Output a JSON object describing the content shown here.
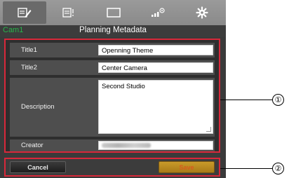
{
  "tabs": [
    {
      "icon": "metadata-edit-icon",
      "active": true
    },
    {
      "icon": "clip-list-icon",
      "active": false
    },
    {
      "icon": "monitor-icon",
      "active": false
    },
    {
      "icon": "signal-settings-icon",
      "active": false
    },
    {
      "icon": "gear-icon",
      "active": false
    }
  ],
  "header": {
    "camera": "Cam1",
    "title": "Planning Metadata"
  },
  "form": {
    "title1": {
      "label": "Title1",
      "value": "Openning Theme"
    },
    "title2": {
      "label": "Title2",
      "value": "Center Camera"
    },
    "description": {
      "label": "Description",
      "value": "Second Studio"
    },
    "creator": {
      "label": "Creator",
      "value": "(blurred)"
    }
  },
  "buttons": {
    "cancel": "Cancel",
    "save": "Save"
  },
  "callouts": {
    "one": "①",
    "two": "②"
  },
  "colors": {
    "highlight": "#d8283a",
    "camera_text": "#26b64a",
    "save_button": "#c89a2a"
  }
}
